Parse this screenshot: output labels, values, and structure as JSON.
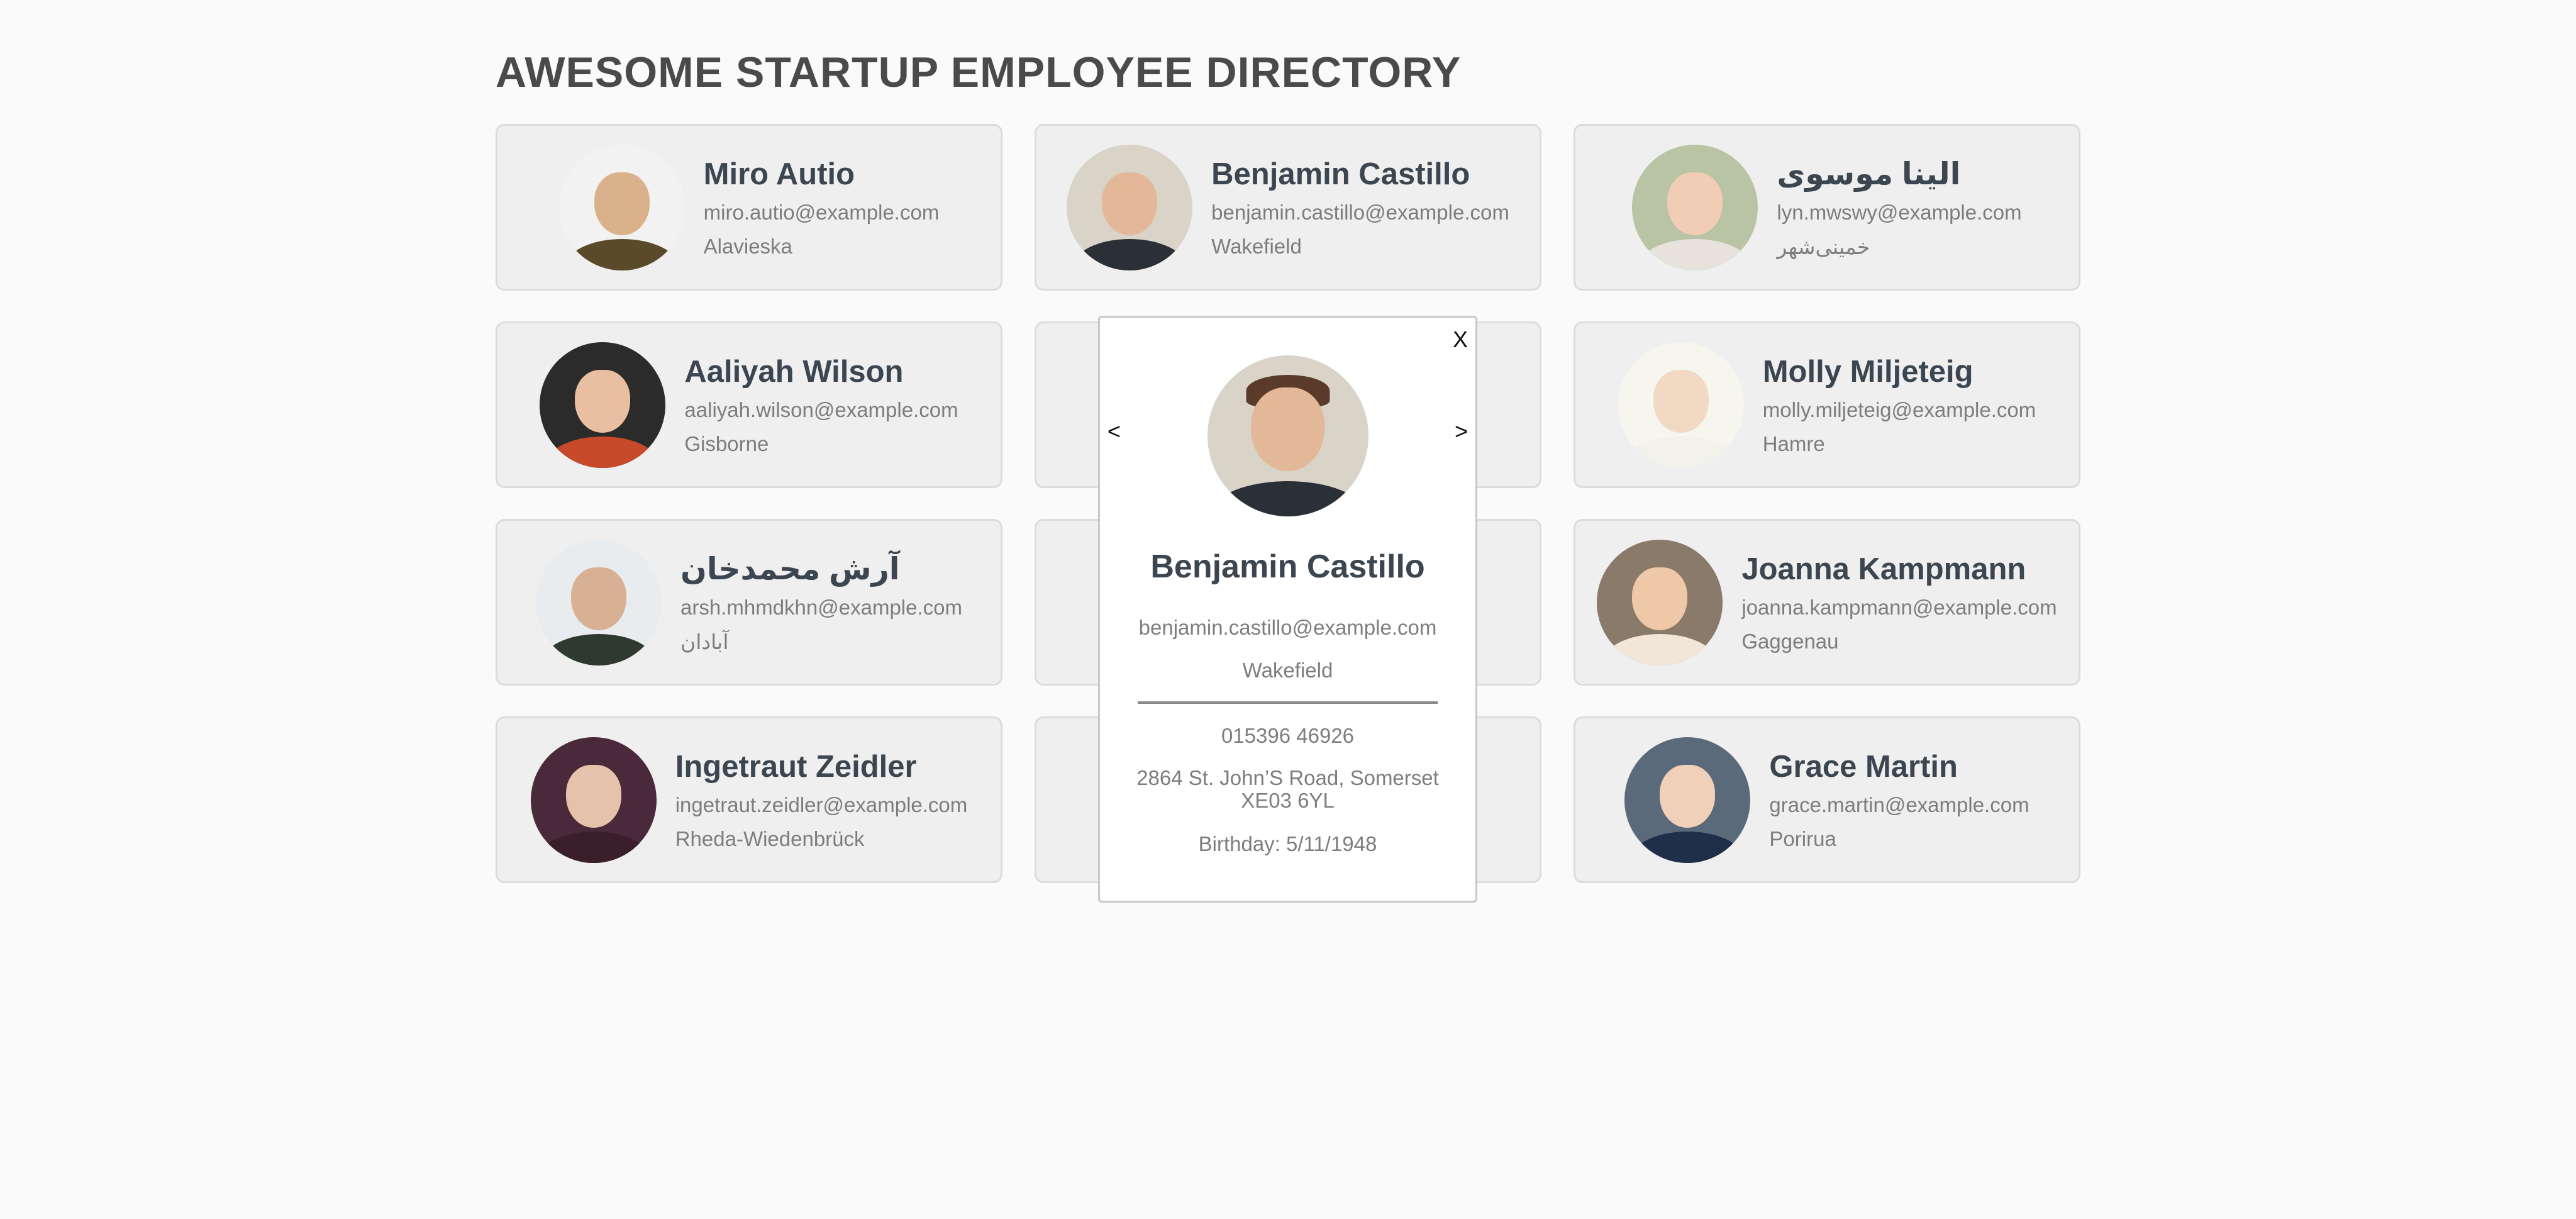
{
  "header": {
    "title": "AWESOME STARTUP EMPLOYEE DIRECTORY"
  },
  "employees": [
    {
      "name": "Miro Autio",
      "email": "miro.autio@example.com",
      "city": "Alavieska",
      "avatar_icon": "person-avatar",
      "skin": "#d9b28c",
      "shirt": "#5a4a2a",
      "bg": "#f2f2f2"
    },
    {
      "name": "Benjamin Castillo",
      "email": "benjamin.castillo@example.com",
      "city": "Wakefield",
      "avatar_icon": "person-avatar",
      "skin": "#e3b898",
      "shirt": "#2b2f36",
      "bg": "#d9d3c8"
    },
    {
      "name": "الینا موسوی",
      "email": "lyn.mwswy@example.com",
      "city": "خمینی‌شهر",
      "avatar_icon": "person-avatar",
      "skin": "#f0cdb4",
      "shirt": "#e8e2dc",
      "bg": "#b9c4a4"
    },
    {
      "name": "Aaliyah Wilson",
      "email": "aaliyah.wilson@example.com",
      "city": "Gisborne",
      "avatar_icon": "person-avatar",
      "skin": "#e8bfa0",
      "shirt": "#c64a2a",
      "bg": "#2b2b2b"
    },
    {
      "name": "",
      "email": "",
      "city": "",
      "avatar_icon": "person-avatar",
      "skin": "#f0c8b8",
      "shirt": "#e9a9a0",
      "bg": "#f3dcd8",
      "hidden": true
    },
    {
      "name": "Molly Miljeteig",
      "email": "molly.miljeteig@example.com",
      "city": "Hamre",
      "avatar_icon": "person-avatar",
      "skin": "#f1d9c4",
      "shirt": "#f2f2ea",
      "bg": "#f6f6ee"
    },
    {
      "name": "آرش محمدخان",
      "email": "arsh.mhmdkhn@example.com",
      "city": "آبادان",
      "avatar_icon": "person-avatar",
      "skin": "#d8b194",
      "shirt": "#2e3a2e",
      "bg": "#e9ecef"
    },
    {
      "name": "",
      "email": "",
      "city": "",
      "avatar_icon": "person-avatar",
      "skin": "#333333",
      "shirt": "#222222",
      "bg": "#bbbbbb",
      "hidden": true
    },
    {
      "name": "Joanna Kampmann",
      "email": "joanna.kampmann@example.com",
      "city": "Gaggenau",
      "avatar_icon": "person-avatar",
      "skin": "#efc8a8",
      "shirt": "#f2e6d8",
      "bg": "#8a7a6a"
    },
    {
      "name": "Ingetraut Zeidler",
      "email": "ingetraut.zeidler@example.com",
      "city": "Rheda-Wiedenbrück",
      "avatar_icon": "person-avatar",
      "skin": "#e6c2ac",
      "shirt": "#3a1f2a",
      "bg": "#4a2a3a"
    },
    {
      "name": "",
      "email": "",
      "city": "",
      "avatar_icon": "person-avatar",
      "skin": "#efefef",
      "shirt": "#efefef",
      "bg": "#efefef",
      "hidden": true
    },
    {
      "name": "Grace Martin",
      "email": "grace.martin@example.com",
      "city": "Porirua",
      "avatar_icon": "person-avatar",
      "skin": "#f0d0b8",
      "shirt": "#1f2f4a",
      "bg": "#5a6a7a"
    }
  ],
  "modal": {
    "close_label": "X",
    "prev_label": "<",
    "next_label": ">",
    "name": "Benjamin Castillo",
    "email": "benjamin.castillo@example.com",
    "city": "Wakefield",
    "phone": "015396 46926",
    "address": "2864 St. John’S Road, Somerset XE03 6YL",
    "birthday": "Birthday: 5/11/1948"
  }
}
